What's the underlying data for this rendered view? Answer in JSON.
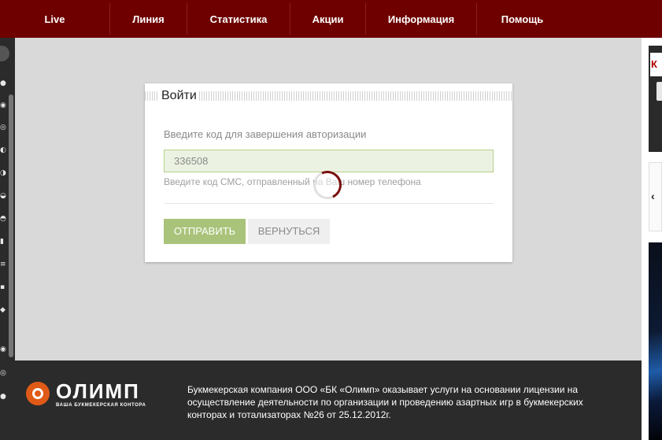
{
  "nav": {
    "items": [
      "Live",
      "Линия",
      "Статистика",
      "Акции",
      "Информация",
      "Помощь"
    ],
    "background": "#6e0000"
  },
  "dialog": {
    "title": "Войти",
    "label": "Введите код для завершения авторизации",
    "code_value": "336508",
    "hint": "Введите код СМС, отправленный на Ваш номер телефона",
    "send_label": "ОТПРАВИТЬ",
    "back_label": "ВЕРНУТЬСЯ",
    "accent": "#a9c37a"
  },
  "footer": {
    "logo_text": "ОЛИМП",
    "logo_sub": "ВАША БУКМЕКЕРСКАЯ КОНТОРА",
    "license_text": "Букмекерская компания ООО «БК «Олимп» оказывает услуги на основании лицензии на осуществление деятельности по организации и проведению азартных игр в букмекерских конторах и тотализаторах №26 от 25.12.2012г."
  },
  "right_panel": {
    "box_letter": "К"
  },
  "icons": {
    "left_strip": [
      "sport-icon",
      "sport-icon",
      "sport-icon",
      "sport-icon",
      "sport-icon",
      "sport-icon",
      "sport-icon",
      "sport-icon",
      "sport-icon",
      "sport-icon",
      "sport-icon",
      "sport-icon",
      "sport-icon",
      "sport-icon"
    ],
    "loading": "spinner-icon",
    "brand": "olimp-logo-icon"
  }
}
